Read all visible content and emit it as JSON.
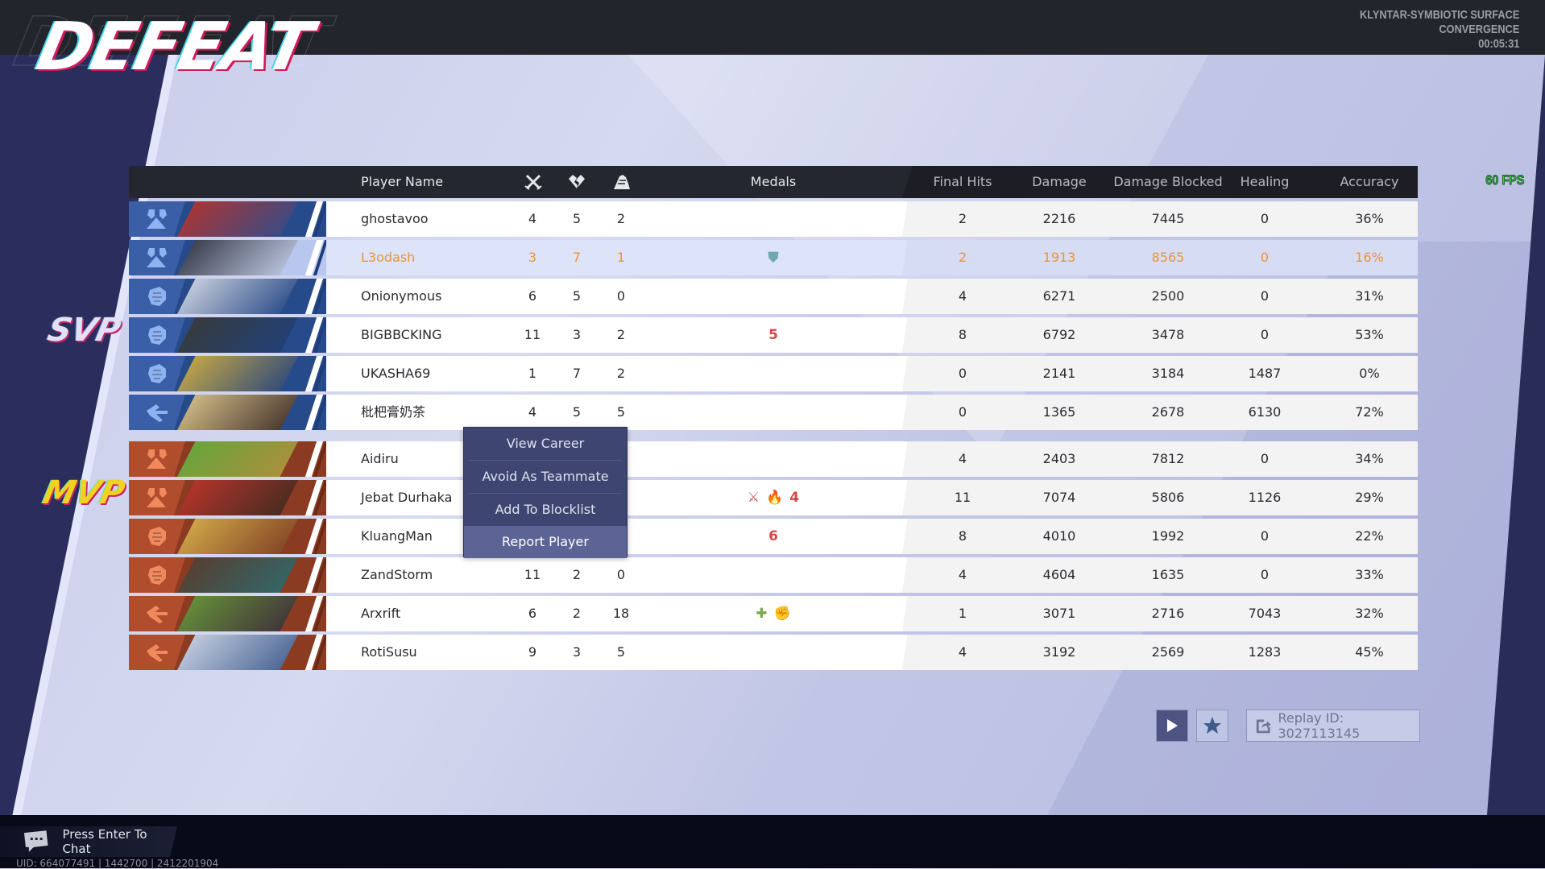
{
  "header": {
    "result_title": "DEFEAT",
    "map_line1": "KLYNTAR-SYMBIOTIC SURFACE",
    "map_line2": "CONVERGENCE",
    "match_time": "00:05:31"
  },
  "fps": "60 FPS",
  "badges": {
    "svp": "SVP",
    "mvp": "MVP"
  },
  "table": {
    "columns": {
      "player_name": "Player Name",
      "kills_icon": "kills-icon",
      "deaths_icon": "deaths-icon",
      "assists_icon": "assists-icon",
      "medals": "Medals",
      "final_hits": "Final Hits",
      "damage": "Damage",
      "damage_blocked": "Damage Blocked",
      "healing": "Healing",
      "accuracy": "Accuracy"
    },
    "team_blue": [
      {
        "role": "vanguard",
        "name": "ghostavoo",
        "k": "4",
        "d": "5",
        "a": "2",
        "medals": [],
        "final_hits": "2",
        "damage": "2216",
        "blocked": "7445",
        "healing": "0",
        "accuracy": "36%"
      },
      {
        "role": "vanguard",
        "name": "L3odash",
        "k": "3",
        "d": "7",
        "a": "1",
        "medals": [
          {
            "icon": "shield-medal-icon",
            "color": "#6fa8b0",
            "glyph": "⛊"
          }
        ],
        "final_hits": "2",
        "damage": "1913",
        "blocked": "8565",
        "healing": "0",
        "accuracy": "16%",
        "is_self": true
      },
      {
        "role": "duelist",
        "name": "Onionymous",
        "k": "6",
        "d": "5",
        "a": "0",
        "medals": [],
        "final_hits": "4",
        "damage": "6271",
        "blocked": "2500",
        "healing": "0",
        "accuracy": "31%"
      },
      {
        "role": "duelist",
        "name": "BIGBBCKING",
        "k": "11",
        "d": "3",
        "a": "2",
        "medals": [
          {
            "icon": "streak-medal-icon",
            "color": "#d84545",
            "glyph": "5"
          }
        ],
        "final_hits": "8",
        "damage": "6792",
        "blocked": "3478",
        "healing": "0",
        "accuracy": "53%"
      },
      {
        "role": "duelist",
        "name": "UKASHA69",
        "k": "1",
        "d": "7",
        "a": "2",
        "medals": [],
        "final_hits": "0",
        "damage": "2141",
        "blocked": "3184",
        "healing": "1487",
        "accuracy": "0%"
      },
      {
        "role": "strategist",
        "name": "枇杷膏奶茶",
        "k": "4",
        "d": "5",
        "a": "5",
        "medals": [],
        "final_hits": "0",
        "damage": "1365",
        "blocked": "2678",
        "healing": "6130",
        "accuracy": "72%"
      }
    ],
    "team_red": [
      {
        "role": "vanguard",
        "name": "Aidiru",
        "k": "",
        "d": "",
        "a": "",
        "medals": [],
        "final_hits": "4",
        "damage": "2403",
        "blocked": "7812",
        "healing": "0",
        "accuracy": "34%"
      },
      {
        "role": "vanguard",
        "name": "Jebat Durhaka",
        "k": "",
        "d": "",
        "a": "",
        "medals": [
          {
            "icon": "crossed-swords-medal-icon",
            "color": "#d65a5a",
            "glyph": "⚔"
          },
          {
            "icon": "fire-medal-icon",
            "color": "#e07a2e",
            "glyph": "🔥"
          },
          {
            "icon": "streak-medal-icon",
            "color": "#d84545",
            "glyph": "4"
          }
        ],
        "final_hits": "11",
        "damage": "7074",
        "blocked": "5806",
        "healing": "1126",
        "accuracy": "29%"
      },
      {
        "role": "duelist",
        "name": "KluangMan",
        "k": "",
        "d": "",
        "a": "",
        "medals": [
          {
            "icon": "streak-medal-icon",
            "color": "#d84545",
            "glyph": "6"
          }
        ],
        "final_hits": "8",
        "damage": "4010",
        "blocked": "1992",
        "healing": "0",
        "accuracy": "22%"
      },
      {
        "role": "duelist",
        "name": "ZandStorm",
        "k": "11",
        "d": "2",
        "a": "0",
        "medals": [],
        "final_hits": "4",
        "damage": "4604",
        "blocked": "1635",
        "healing": "0",
        "accuracy": "33%"
      },
      {
        "role": "strategist",
        "name": "Arxrift",
        "k": "6",
        "d": "2",
        "a": "18",
        "medals": [
          {
            "icon": "healing-cross-medal-icon",
            "color": "#7da84f",
            "glyph": "✚"
          },
          {
            "icon": "fist-medal-icon",
            "color": "#c2a35a",
            "glyph": "✊"
          }
        ],
        "final_hits": "1",
        "damage": "3071",
        "blocked": "2716",
        "healing": "7043",
        "accuracy": "32%"
      },
      {
        "role": "strategist",
        "name": "RotiSusu",
        "k": "9",
        "d": "3",
        "a": "5",
        "medals": [],
        "final_hits": "4",
        "damage": "3192",
        "blocked": "2569",
        "healing": "1283",
        "accuracy": "45%"
      }
    ]
  },
  "context_menu": {
    "items": [
      "View Career",
      "Avoid As Teammate",
      "Add To Blocklist",
      "Report Player"
    ],
    "highlighted": "Report Player"
  },
  "replay": {
    "play_icon": "play-icon",
    "favorite_icon": "star-icon",
    "replay_label": "Replay ID: 3027113145"
  },
  "footer": {
    "chat_prompt": "Press Enter To Chat",
    "uid_line": "UID: 664077491 | 1442700 | 2412201904"
  },
  "colors": {
    "self_highlight": "#e9953a",
    "team_blue": "#274a8b",
    "team_red": "#8b3b22",
    "fps_green": "#3fc054"
  }
}
